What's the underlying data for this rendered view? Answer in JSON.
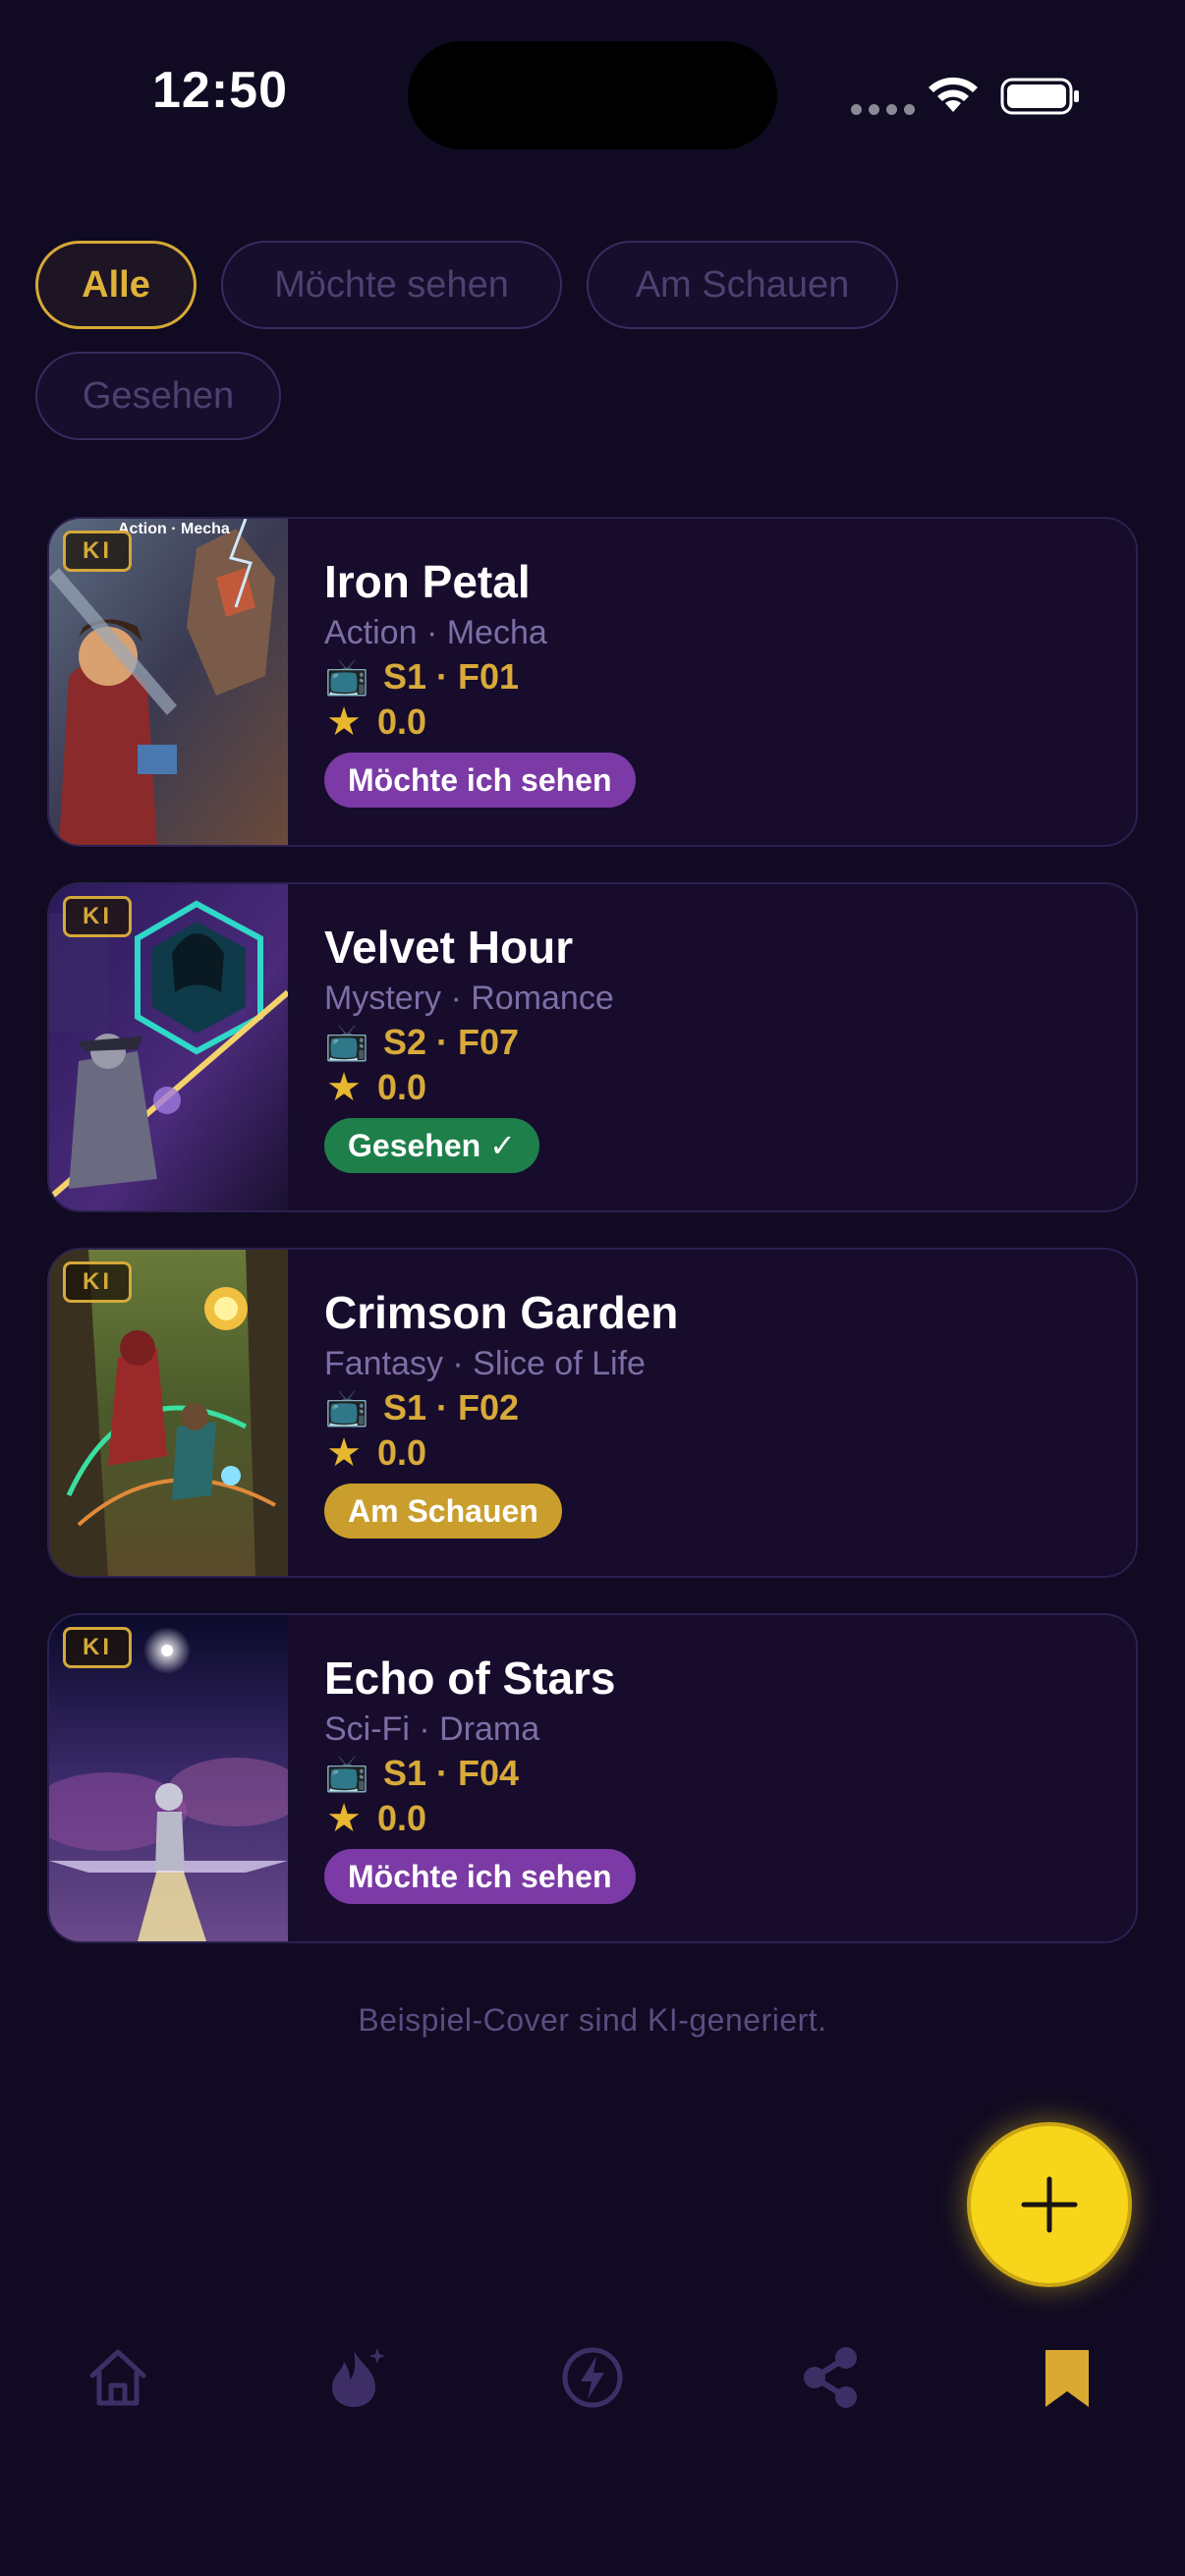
{
  "status_bar": {
    "time": "12:50"
  },
  "filters": [
    {
      "label": "Alle",
      "active": true
    },
    {
      "label": "Möchte sehen",
      "active": false
    },
    {
      "label": "Am Schauen",
      "active": false
    },
    {
      "label": "Gesehen",
      "active": false
    }
  ],
  "shows": [
    {
      "title": "Iron Petal",
      "genres": "Action · Mecha",
      "episode": "S1 · F01",
      "rating": "0.0",
      "status": "Möchte ich sehen",
      "status_color": "#7b3aa5",
      "badge": "KI",
      "cover_caption": "Action · Mecha"
    },
    {
      "title": "Velvet Hour",
      "genres": "Mystery · Romance",
      "episode": "S2 · F07",
      "rating": "0.0",
      "status": "Gesehen ✓",
      "status_color": "#1e7f4a",
      "badge": "KI"
    },
    {
      "title": "Crimson Garden",
      "genres": "Fantasy · Slice of Life",
      "episode": "S1 · F02",
      "rating": "0.0",
      "status": "Am Schauen",
      "status_color": "#c99e2c",
      "badge": "KI"
    },
    {
      "title": "Echo of Stars",
      "genres": "Sci-Fi · Drama",
      "episode": "S1 · F04",
      "rating": "0.0",
      "status": "Möchte ich sehen",
      "status_color": "#7b3aa5",
      "badge": "KI"
    }
  ],
  "footnote": "Beispiel-Cover sind KI-generiert.",
  "fab": {
    "icon": "plus-icon"
  },
  "tabbar": [
    {
      "icon": "home-icon",
      "active": false
    },
    {
      "icon": "flame-icon",
      "active": false
    },
    {
      "icon": "lightning-icon",
      "active": false
    },
    {
      "icon": "share-icon",
      "active": false
    },
    {
      "icon": "bookmark-icon",
      "active": true
    }
  ],
  "colors": {
    "background": "#100a22",
    "accent": "#e0b23a",
    "card": "#170c2c",
    "fab": "#f7d51a"
  }
}
